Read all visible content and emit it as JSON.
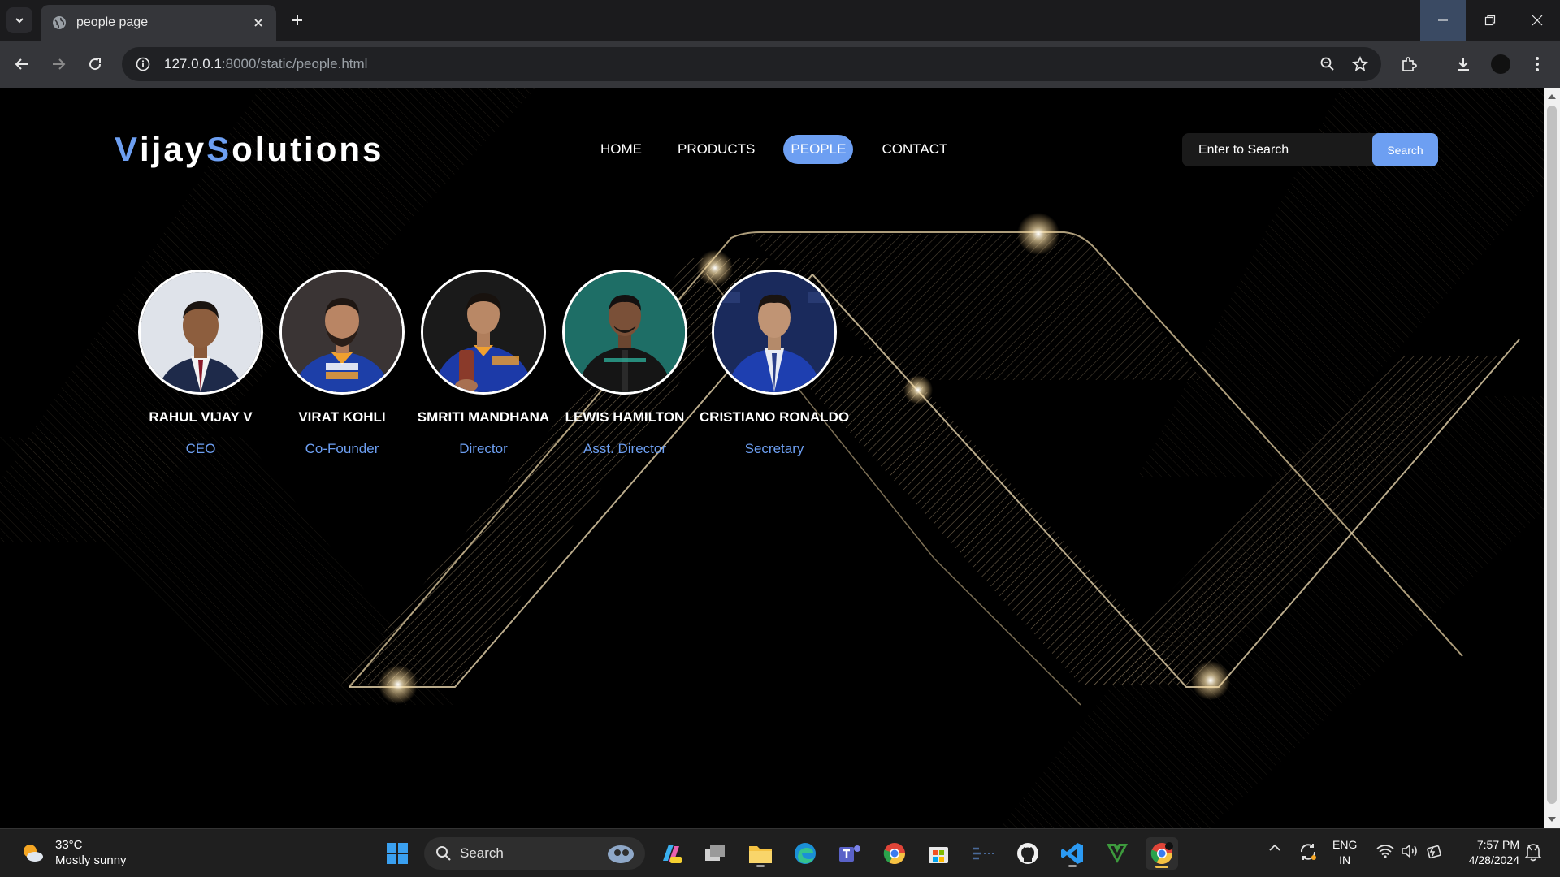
{
  "browser": {
    "tab_title": "people page",
    "url_host": "127.0.0.1",
    "url_rest": ":8000/static/people.html"
  },
  "site": {
    "logo_parts": [
      "V",
      "ijay",
      "S",
      "olutions"
    ],
    "nav": [
      {
        "label": "HOME",
        "active": false
      },
      {
        "label": "PRODUCTS",
        "active": false
      },
      {
        "label": "PEOPLE",
        "active": true
      },
      {
        "label": "CONTACT",
        "active": false
      }
    ],
    "search": {
      "placeholder": "Enter to Search",
      "button": "Search"
    },
    "accent_color": "#6d9ff2"
  },
  "people": [
    {
      "name": "RAHUL VIJAY V",
      "role": "CEO",
      "photo_bg": "#dfe3ea",
      "suit": "#1e2a4a"
    },
    {
      "name": "VIRAT KOHLI",
      "role": "Co-Founder",
      "photo_bg": "#3a3434",
      "suit": "#1d3fa8"
    },
    {
      "name": "SMRITI MANDHANA",
      "role": "Director",
      "photo_bg": "#1a1a1a",
      "suit": "#1c3aa8"
    },
    {
      "name": "LEWIS HAMILTON",
      "role": "Asst. Director",
      "photo_bg": "#1e6e66",
      "suit": "#151515"
    },
    {
      "name": "CRISTIANO RONALDO",
      "role": "Secretary",
      "photo_bg": "#1a2a5c",
      "suit": "#1e3fb0"
    }
  ],
  "taskbar": {
    "weather_temp": "33°C",
    "weather_desc": "Mostly sunny",
    "search_label": "Search",
    "lang_1": "ENG",
    "lang_2": "IN",
    "time": "7:57 PM",
    "date": "4/28/2024"
  }
}
